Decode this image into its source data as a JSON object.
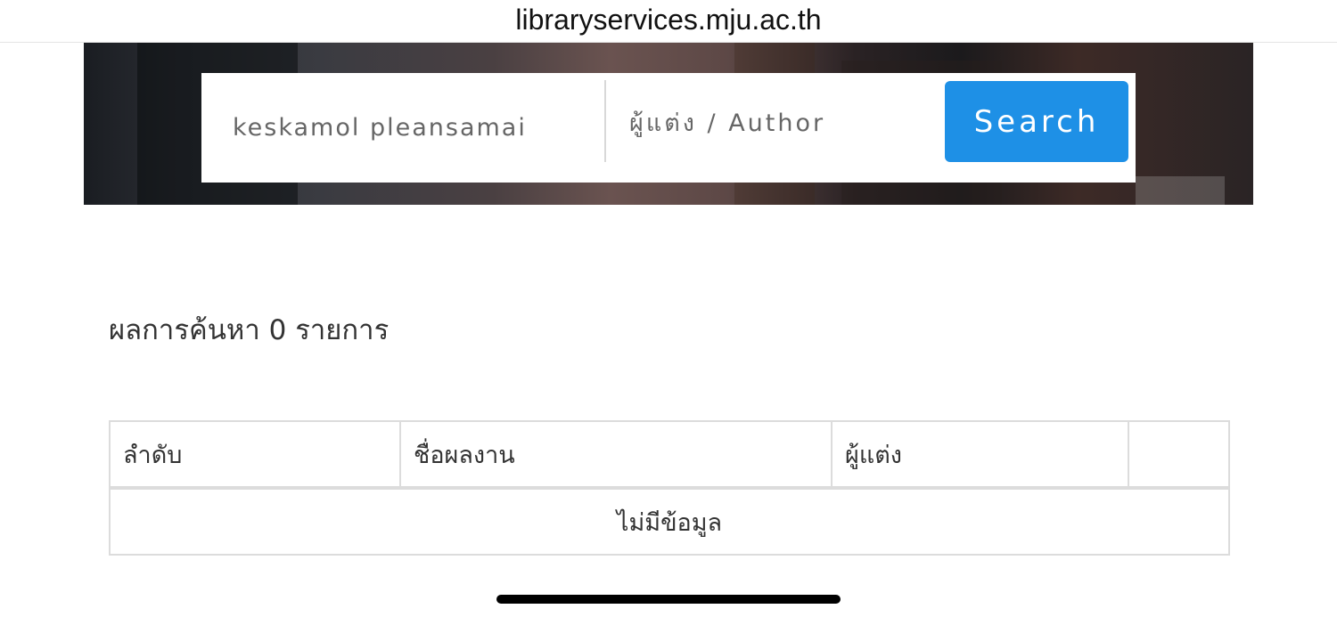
{
  "browser": {
    "url": "libraryservices.mju.ac.th"
  },
  "search": {
    "query_value": "keskamol pleansamai",
    "field_type": "ผู้แต่ง / Author",
    "button_label": "Search"
  },
  "results": {
    "summary": "ผลการค้นหา 0 รายการ",
    "columns": [
      "ลำดับ",
      "ชื่อผลงาน",
      "ผู้แต่ง",
      ""
    ],
    "empty_message": "ไม่มีข้อมูล"
  },
  "colors": {
    "accent": "#1e90e6"
  }
}
